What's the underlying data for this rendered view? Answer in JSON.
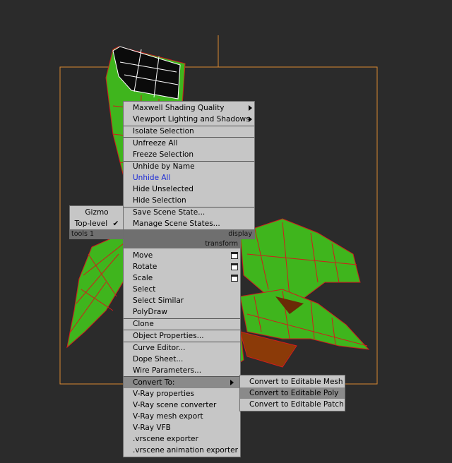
{
  "colors": {
    "background": "#2b2b2b",
    "viewport_border": "#d98830",
    "mesh_green": "#3fb51d",
    "wire_red": "#d11c1c",
    "menu_bg": "#c6c6c6",
    "menu_highlight": "#8a8a8a",
    "quad_bar": "#6f6f6f",
    "unhide_all_text": "#1c2bd6"
  },
  "left_quad": {
    "items": [
      {
        "label": "Gizmo",
        "checked": false
      },
      {
        "label": "Top-level",
        "checked": true
      }
    ],
    "footer_label": "tools 1"
  },
  "display_quad": {
    "items": [
      {
        "label": "Maxwell Shading Quality",
        "submenu": true
      },
      {
        "label": "Viewport Lighting and Shadows",
        "submenu": true
      },
      {
        "label": "Isolate Selection"
      },
      {
        "label": "Unfreeze All"
      },
      {
        "label": "Freeze Selection"
      },
      {
        "label": "Unhide by Name"
      },
      {
        "label": "Unhide All",
        "highlight_text": true
      },
      {
        "label": "Hide Unselected"
      },
      {
        "label": "Hide Selection"
      },
      {
        "label": "Save Scene State..."
      },
      {
        "label": "Manage Scene States..."
      }
    ],
    "footer_label": "display"
  },
  "transform_quad": {
    "header_label": "transform",
    "items": [
      {
        "label": "Move",
        "settings_icon": "window-icon"
      },
      {
        "label": "Rotate",
        "settings_icon": "window-icon"
      },
      {
        "label": "Scale",
        "settings_icon": "window-icon"
      },
      {
        "label": "Select"
      },
      {
        "label": "Select Similar"
      },
      {
        "label": "PolyDraw"
      },
      {
        "label": "Clone"
      },
      {
        "label": "Object Properties..."
      },
      {
        "label": "Curve Editor..."
      },
      {
        "label": "Dope Sheet..."
      },
      {
        "label": "Wire Parameters..."
      },
      {
        "label": "Convert To:",
        "submenu": true,
        "active": true
      },
      {
        "label": "V-Ray properties"
      },
      {
        "label": "V-Ray scene converter"
      },
      {
        "label": "V-Ray mesh export"
      },
      {
        "label": "V-Ray VFB"
      },
      {
        "label": ".vrscene exporter"
      },
      {
        "label": ".vrscene animation exporter"
      }
    ]
  },
  "convert_submenu": {
    "items": [
      {
        "label": "Convert to Editable Mesh"
      },
      {
        "label": "Convert to Editable Poly",
        "active": true
      },
      {
        "label": "Convert to Editable Patch"
      }
    ]
  }
}
